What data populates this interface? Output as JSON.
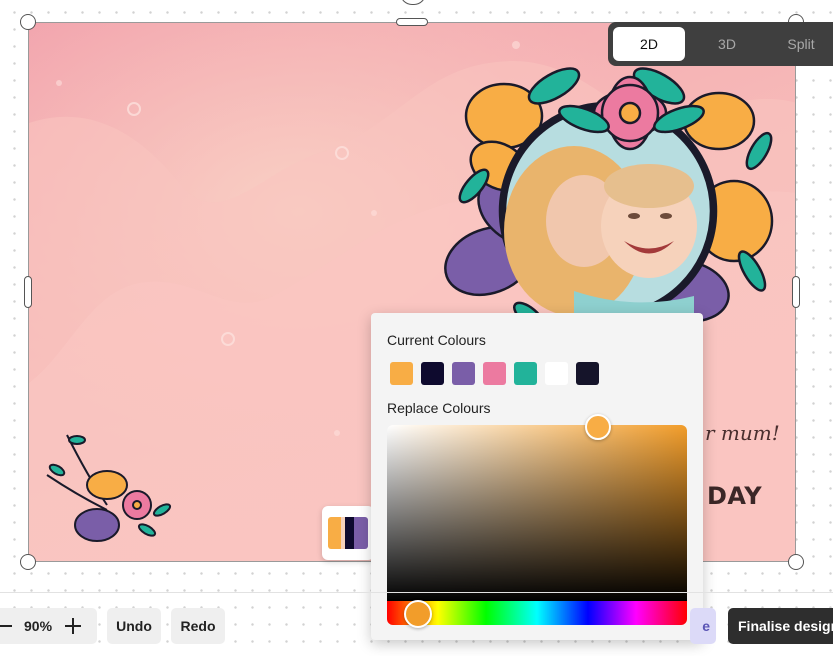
{
  "view_toggle": {
    "options": [
      "2D",
      "3D",
      "Split"
    ],
    "active": "2D"
  },
  "card": {
    "greeting_line1": "r mum!",
    "greeting_line2": "DAY",
    "background_color": "#f7b9b8",
    "photo_subject": "mother-and-baby-photo"
  },
  "color_popup": {
    "current_title": "Current Colours",
    "current_colours": [
      "#f8ad45",
      "#0e0a2e",
      "#7a5ea8",
      "#ec7aa0",
      "#22b39a",
      "#ffffff",
      "#15142a"
    ],
    "replace_title": "Replace Colours",
    "picker_colour": "#f29d2a"
  },
  "swatch_chip_colours": [
    "#f8ad45",
    "#0e0a2e",
    "#7a5ea8"
  ],
  "toolbar": {
    "zoom_value": "90%",
    "undo_label": "Undo",
    "redo_label": "Redo",
    "ghost_label": "e",
    "finalise_label": "Finalise design"
  }
}
